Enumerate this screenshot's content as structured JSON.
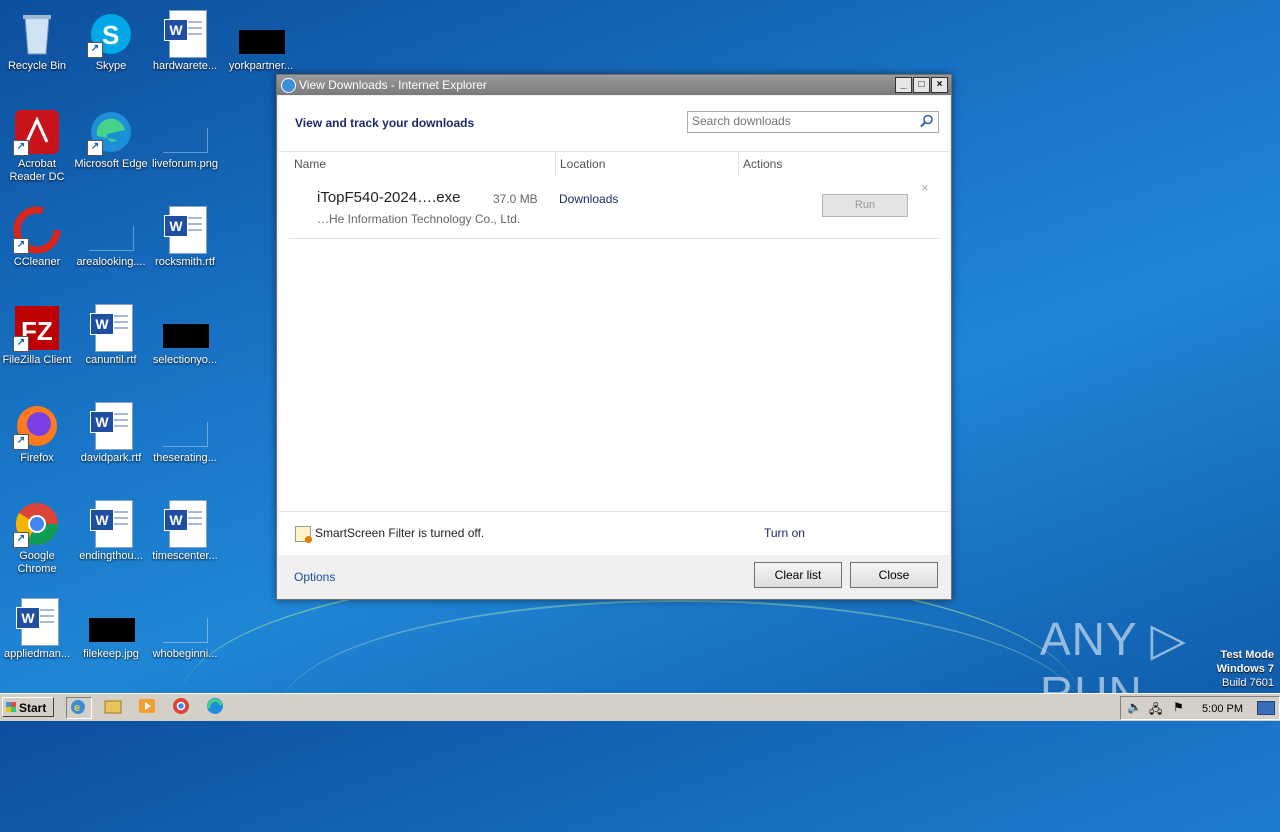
{
  "desktop": {
    "icons": [
      {
        "label": "Recycle Bin"
      },
      {
        "label": "Skype"
      },
      {
        "label": "hardwarete..."
      },
      {
        "label": "yorkpartner..."
      },
      {
        "label": "Acrobat Reader DC"
      },
      {
        "label": "Microsoft Edge"
      },
      {
        "label": "liveforum.png"
      },
      {
        "label": "CCleaner"
      },
      {
        "label": "arealooking...."
      },
      {
        "label": "rocksmith.rtf"
      },
      {
        "label": "FileZilla Client"
      },
      {
        "label": "canuntil.rtf"
      },
      {
        "label": "selectionyo..."
      },
      {
        "label": "Firefox"
      },
      {
        "label": "davidpark.rtf"
      },
      {
        "label": "theserating..."
      },
      {
        "label": "Google Chrome"
      },
      {
        "label": "endingthou..."
      },
      {
        "label": "timescenter..."
      },
      {
        "label": "appliedman..."
      },
      {
        "label": "filekeep.jpg"
      },
      {
        "label": "whobeginni..."
      }
    ]
  },
  "window": {
    "title": "View Downloads - Internet Explorer",
    "header": "View and track your downloads",
    "search_placeholder": "Search downloads",
    "columns": {
      "name": "Name",
      "location": "Location",
      "actions": "Actions"
    },
    "download": {
      "filename": "iTopF540-2024….exe",
      "size": "37.0 MB",
      "publisher": "…He Information Technology Co., Ltd.",
      "location": "Downloads",
      "action": "Run",
      "remove": "×"
    },
    "smartscreen": {
      "text": "SmartScreen Filter is turned off.",
      "action": "Turn on"
    },
    "footer": {
      "options": "Options",
      "clear": "Clear list",
      "close": "Close"
    },
    "controls": {
      "minimize": "_",
      "maximize": "□",
      "close": "×"
    }
  },
  "taskbar": {
    "start": "Start",
    "clock": "5:00 PM"
  },
  "watermark": "ANY ▷ RUN",
  "testmode": {
    "line1": "Test Mode",
    "line2": "Windows 7",
    "line3": "Build 7601"
  }
}
